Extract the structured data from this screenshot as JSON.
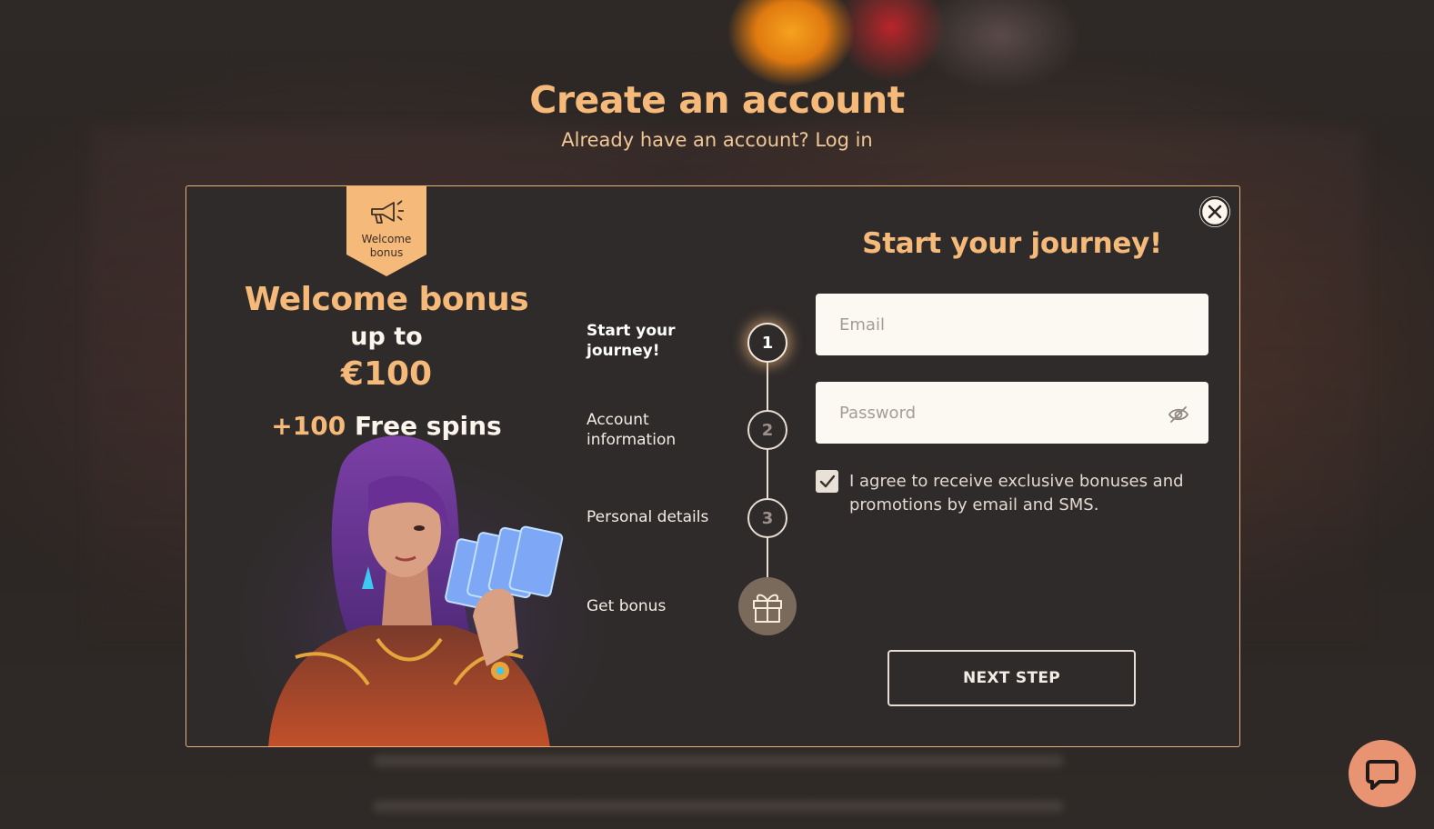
{
  "page": {
    "title": "Create an account",
    "login_prompt": "Already have an account?",
    "login_link": "Log in"
  },
  "modal": {
    "ribbon": {
      "icon": "megaphone-icon",
      "label": "Welcome bonus"
    },
    "promo": {
      "title": "Welcome bonus",
      "up_to": "up to",
      "amount": "€100",
      "spins_number": "+100",
      "spins_text": "Free spins"
    },
    "steps": [
      {
        "label": "Start your journey!",
        "marker": "1",
        "active": true
      },
      {
        "label": "Account information",
        "marker": "2",
        "active": false
      },
      {
        "label": "Personal details",
        "marker": "3",
        "active": false
      },
      {
        "label": "Get bonus",
        "marker": "gift-icon",
        "active": false
      }
    ],
    "form": {
      "title": "Start your journey!",
      "email_placeholder": "Email",
      "email_value": "",
      "password_placeholder": "Password",
      "password_value": "",
      "consent_checked": true,
      "consent_text": "I agree to receive exclusive bonuses and promotions by email and SMS.",
      "next_label": "NEXT STEP"
    }
  },
  "colors": {
    "accent": "#f5b97a",
    "modal_bg": "#2f2b2a",
    "chat_button": "#e89472"
  }
}
